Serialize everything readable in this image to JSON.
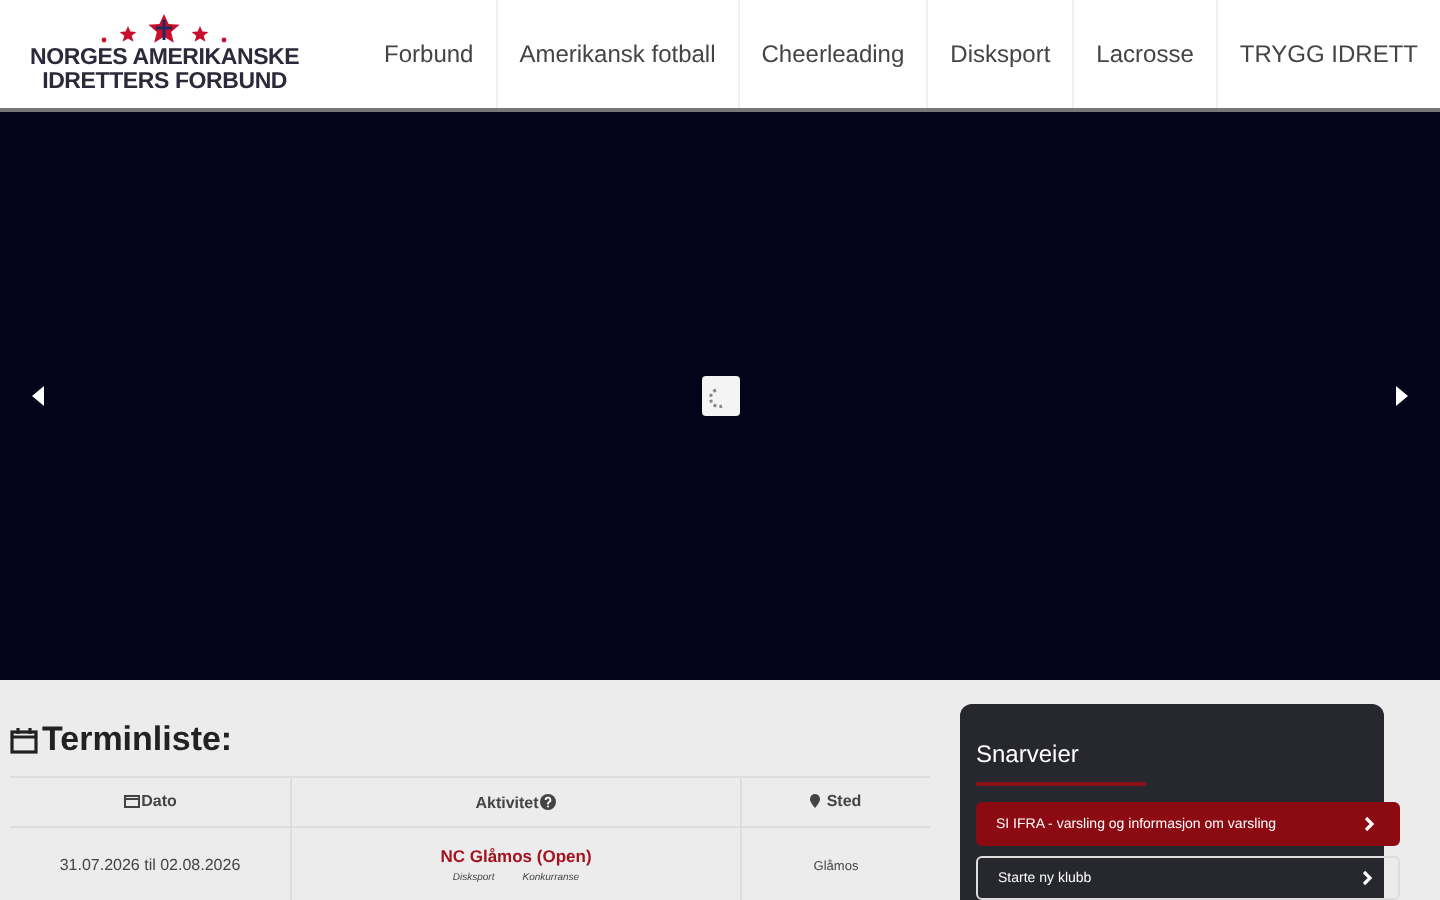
{
  "logo": {
    "line_1": "NORGES AMERIKANSKE",
    "line_2": "IDRETTERS FORBUND"
  },
  "nav": [
    "Forbund",
    "Amerikansk fotball",
    "Cheerleading",
    "Disksport",
    "Lacrosse",
    "TRYGG IDRETT"
  ],
  "terminliste": {
    "title": "Terminliste:",
    "columns": [
      "Dato",
      "Aktivitet",
      "Sted"
    ],
    "rows": [
      {
        "date": "31.07.2026 til 02.08.2026",
        "activity": "NC Glåmos (Open)",
        "tags": [
          "Disksport",
          "Konkurranse"
        ],
        "place": "Glåmos"
      }
    ]
  },
  "shortcuts": {
    "title": "Snarveier",
    "links": [
      {
        "label": "SI IFRA - varsling og informasjon om varsling",
        "kind": "primary"
      },
      {
        "label": "Starte ny klubb",
        "kind": "outline"
      }
    ]
  }
}
